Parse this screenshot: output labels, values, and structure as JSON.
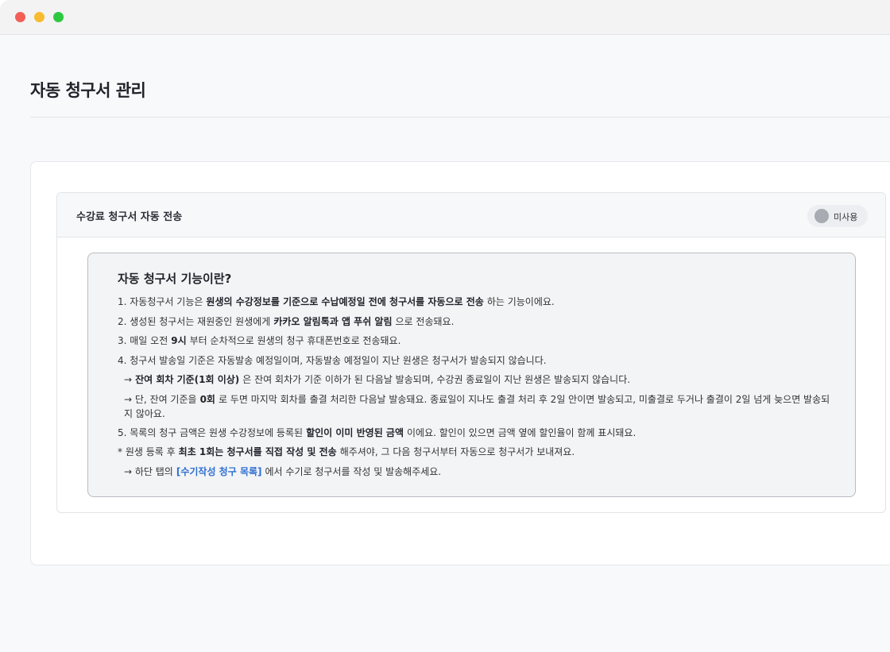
{
  "page": {
    "title": "자동 청구서 관리"
  },
  "section": {
    "title": "수강료 청구서 자동 전송",
    "toggle_label": "미사용"
  },
  "info": {
    "title": "자동 청구서 기능이란?",
    "l1": {
      "a": "1. 자동청구서 기능은",
      "b": "원생의 수강정보를 기준으로 수납예정일 전에 청구서를 자동으로 전송",
      "c": "하는 기능이에요."
    },
    "l2": {
      "a": "2. 생성된 청구서는 재원중인 원생에게",
      "b": "카카오 알림톡과 앱 푸쉬 알림",
      "c": "으로 전송돼요."
    },
    "l3": {
      "a": "3. 매일 오전",
      "b": "9시",
      "c": "부터 순차적으로 원생의 청구 휴대폰번호로 전송돼요."
    },
    "l4": {
      "a": "4. 청구서 발송일 기준은 자동발송 예정일이며, 자동발송 예정일이 지난 원생은 청구서가 발송되지 않습니다."
    },
    "l5": {
      "a": "→",
      "b": "잔여 회차 기준(1회 이상)",
      "c": "은 잔여 회차가 기준 이하가 된 다음날 발송되며, 수강권 종료일이 지난 원생은 발송되지 않습니다."
    },
    "l6": {
      "a": "→ 단, 잔여 기준을",
      "b": "0회",
      "c": "로 두면 마지막 회차를 출결 처리한 다음날 발송돼요. 종료일이 지나도 출결 처리 후 2일 안이면 발송되고, 미출결로 두거나 출결이 2일 넘게 늦으면 발송되지 않아요."
    },
    "l7": {
      "a": "5. 목록의 청구 금액은 원생 수강정보에 등록된",
      "b": "할인이 이미 반영된 금액",
      "c": "이에요. 할인이 있으면 금액 옆에 할인율이 함께 표시돼요."
    },
    "l8": {
      "a": "* 원생 등록 후",
      "b": "최초 1회는 청구서를 직접 작성 및 전송",
      "c": "해주셔야, 그 다음 청구서부터 자동으로 청구서가 보내져요."
    },
    "l9": {
      "a": "→ 하단 탭의",
      "link": "[수기작성 청구 목록]",
      "c": "에서 수기로 청구서를 작성 및 발송해주세요."
    }
  }
}
